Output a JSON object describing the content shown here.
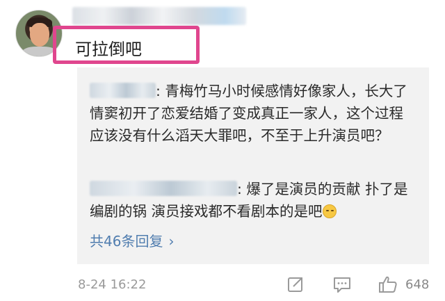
{
  "comment": {
    "text": "可拉倒吧",
    "timestamp": "8-24 16:22",
    "like_count": "648"
  },
  "replies": [
    {
      "text": ": 青梅竹马小时候感情好像家人，长大了情窦初开了恋爱结婚了变成真正一家人，这个过程应该没有什么滔天大罪吧，不至于上升演员吧？"
    },
    {
      "text": ": 爆了是演员的贡献 扑了是编剧的锅 演员接戏都不看剧本的是吧"
    }
  ],
  "more_replies": {
    "label": "共46条回复",
    "chevron": "›"
  },
  "icons": {
    "share": "share-icon",
    "comment": "comment-icon",
    "like": "thumbs-up-icon"
  },
  "colors": {
    "highlight": "#e0468e",
    "link": "#507daf",
    "panel": "#f2f2f2"
  }
}
